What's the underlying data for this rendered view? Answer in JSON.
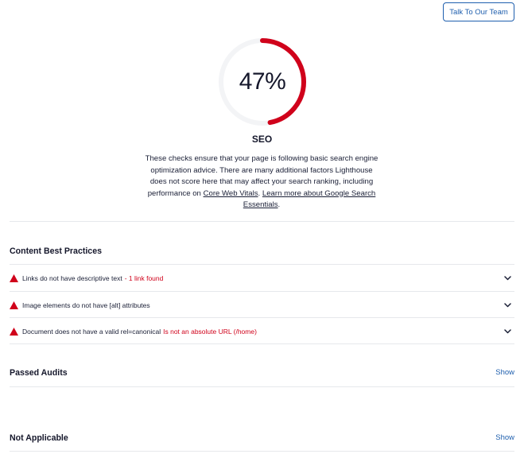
{
  "header": {
    "talk_button_label": "Talk To Our Team"
  },
  "score": {
    "value_label": "47%",
    "fraction": 0.47,
    "color": "#d0021b",
    "track_color": "#f3f4f6"
  },
  "seo": {
    "title": "SEO",
    "description_before": "These checks ensure that your page is following basic search engine optimization advice. There are many additional factors Lighthouse does not score here that may affect your search ranking, including performance on ",
    "core_web_vitals_link": "Core Web Vitals",
    "description_middle": ". ",
    "learn_more_link": "Learn more about Google Search Essentials",
    "description_after": "."
  },
  "content_best_practices": {
    "title": "Content Best Practices",
    "audits": [
      {
        "label": "Links do not have descriptive text",
        "detail": "- 1 link found",
        "icon": "warning-triangle-icon"
      },
      {
        "label": "Image elements do not have [alt] attributes",
        "detail": "",
        "icon": "warning-triangle-icon"
      },
      {
        "label": "Document does not have a valid rel=canonical",
        "detail": "Is not an absolute URL (/home)",
        "icon": "warning-triangle-icon"
      }
    ]
  },
  "passed_audits": {
    "title": "Passed Audits",
    "show_label": "Show"
  },
  "not_applicable": {
    "title": "Not Applicable",
    "show_label": "Show"
  },
  "colors": {
    "accent": "#1f5fae",
    "error": "#d0021b",
    "divider": "#e6e8ec"
  }
}
